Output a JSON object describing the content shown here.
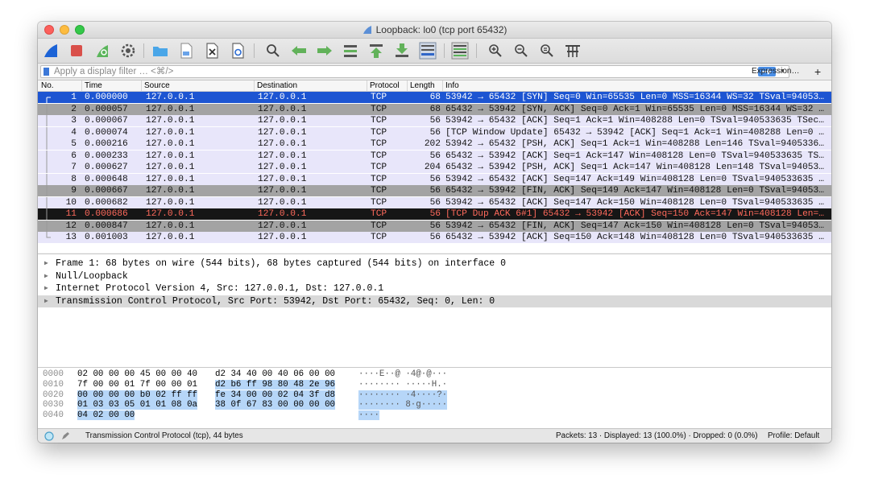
{
  "window": {
    "title": "Loopback: lo0 (tcp port 65432)"
  },
  "filter": {
    "placeholder": "Apply a display filter … <⌘/>",
    "expression_label": "Expression…",
    "add_label": "+"
  },
  "columns": [
    "No.",
    "Time",
    "Source",
    "Destination",
    "Protocol",
    "Length",
    "Info"
  ],
  "packets": [
    {
      "no": "1",
      "time": "0.000000",
      "src": "127.0.0.1",
      "dst": "127.0.0.1",
      "proto": "TCP",
      "len": "68",
      "info": "53942 → 65432 [SYN] Seq=0 Win=65535 Len=0 MSS=16344 WS=32 TSval=94053…",
      "style": "selected"
    },
    {
      "no": "2",
      "time": "0.000057",
      "src": "127.0.0.1",
      "dst": "127.0.0.1",
      "proto": "TCP",
      "len": "68",
      "info": "65432 → 53942 [SYN, ACK] Seq=0 Ack=1 Win=65535 Len=0 MSS=16344 WS=32 …",
      "style": "gray"
    },
    {
      "no": "3",
      "time": "0.000067",
      "src": "127.0.0.1",
      "dst": "127.0.0.1",
      "proto": "TCP",
      "len": "56",
      "info": "53942 → 65432 [ACK] Seq=1 Ack=1 Win=408288 Len=0 TSval=940533635 TSec…",
      "style": "normal"
    },
    {
      "no": "4",
      "time": "0.000074",
      "src": "127.0.0.1",
      "dst": "127.0.0.1",
      "proto": "TCP",
      "len": "56",
      "info": "[TCP Window Update] 65432 → 53942 [ACK] Seq=1 Ack=1 Win=408288 Len=0 …",
      "style": "normal"
    },
    {
      "no": "5",
      "time": "0.000216",
      "src": "127.0.0.1",
      "dst": "127.0.0.1",
      "proto": "TCP",
      "len": "202",
      "info": "53942 → 65432 [PSH, ACK] Seq=1 Ack=1 Win=408288 Len=146 TSval=9405336…",
      "style": "normal"
    },
    {
      "no": "6",
      "time": "0.000233",
      "src": "127.0.0.1",
      "dst": "127.0.0.1",
      "proto": "TCP",
      "len": "56",
      "info": "65432 → 53942 [ACK] Seq=1 Ack=147 Win=408128 Len=0 TSval=940533635 TS…",
      "style": "normal"
    },
    {
      "no": "7",
      "time": "0.000627",
      "src": "127.0.0.1",
      "dst": "127.0.0.1",
      "proto": "TCP",
      "len": "204",
      "info": "65432 → 53942 [PSH, ACK] Seq=1 Ack=147 Win=408128 Len=148 TSval=94053…",
      "style": "normal"
    },
    {
      "no": "8",
      "time": "0.000648",
      "src": "127.0.0.1",
      "dst": "127.0.0.1",
      "proto": "TCP",
      "len": "56",
      "info": "53942 → 65432 [ACK] Seq=147 Ack=149 Win=408128 Len=0 TSval=940533635 …",
      "style": "normal"
    },
    {
      "no": "9",
      "time": "0.000667",
      "src": "127.0.0.1",
      "dst": "127.0.0.1",
      "proto": "TCP",
      "len": "56",
      "info": "65432 → 53942 [FIN, ACK] Seq=149 Ack=147 Win=408128 Len=0 TSval=94053…",
      "style": "gray"
    },
    {
      "no": "10",
      "time": "0.000682",
      "src": "127.0.0.1",
      "dst": "127.0.0.1",
      "proto": "TCP",
      "len": "56",
      "info": "53942 → 65432 [ACK] Seq=147 Ack=150 Win=408128 Len=0 TSval=940533635 …",
      "style": "normal"
    },
    {
      "no": "11",
      "time": "0.000686",
      "src": "127.0.0.1",
      "dst": "127.0.0.1",
      "proto": "TCP",
      "len": "56",
      "info": "[TCP Dup ACK 6#1] 65432 → 53942 [ACK] Seq=150 Ack=147 Win=408128 Len=…",
      "style": "error"
    },
    {
      "no": "12",
      "time": "0.000847",
      "src": "127.0.0.1",
      "dst": "127.0.0.1",
      "proto": "TCP",
      "len": "56",
      "info": "53942 → 65432 [FIN, ACK] Seq=147 Ack=150 Win=408128 Len=0 TSval=94053…",
      "style": "gray"
    },
    {
      "no": "13",
      "time": "0.001003",
      "src": "127.0.0.1",
      "dst": "127.0.0.1",
      "proto": "TCP",
      "len": "56",
      "info": "65432 → 53942 [ACK] Seq=150 Ack=148 Win=408128 Len=0 TSval=940533635 …",
      "style": "normal"
    }
  ],
  "details": [
    {
      "text": "Frame 1: 68 bytes on wire (544 bits), 68 bytes captured (544 bits) on interface 0",
      "selected": false
    },
    {
      "text": "Null/Loopback",
      "selected": false
    },
    {
      "text": "Internet Protocol Version 4, Src: 127.0.0.1, Dst: 127.0.0.1",
      "selected": false
    },
    {
      "text": "Transmission Control Protocol, Src Port: 53942, Dst Port: 65432, Seq: 0, Len: 0",
      "selected": true
    }
  ],
  "bytes": [
    {
      "offset": "0000",
      "hex1": "02 00 00 00 45 00 00 40",
      "hex2": "d2 34 40 00 40 06 00 00",
      "ascii": "····E··@ ·4@·@···",
      "hl": 0
    },
    {
      "offset": "0010",
      "hex1": "7f 00 00 01 7f 00 00 01",
      "hex2": "d2 b6 ff 98 80 48 2e 96",
      "ascii": "········ ·····H.·",
      "hl": 1
    },
    {
      "offset": "0020",
      "hex1": "00 00 00 00 b0 02 ff ff",
      "hex2": "fe 34 00 00 02 04 3f d8",
      "ascii": "········ ·4····?·",
      "hl": 2
    },
    {
      "offset": "0030",
      "hex1": "01 03 03 05 01 01 08 0a",
      "hex2": "38 0f 67 83 00 00 00 00",
      "ascii": "········ 8·g·····",
      "hl": 2
    },
    {
      "offset": "0040",
      "hex1": "04 02 00 00",
      "hex2": "",
      "ascii": "····",
      "hl": 3
    }
  ],
  "status": {
    "left": "Transmission Control Protocol (tcp), 44 bytes",
    "right": "Packets: 13 · Displayed: 13 (100.0%) · Dropped: 0 (0.0%)",
    "profile": "Profile: Default"
  },
  "colors": {
    "selected_bg": "#1d55d2",
    "gray_bg": "#a3a3a3",
    "normal_bg": "#e8e6fa",
    "error_bg": "#161616",
    "error_fg": "#ff6a5c",
    "bytes_highlight": "#b6d6f8"
  },
  "toolbar_icons": [
    "shark-fin-start-icon",
    "stop-icon",
    "restart-icon",
    "options-gear-icon",
    "open-folder-icon",
    "save-file-icon",
    "close-file-icon",
    "reload-icon",
    "find-icon",
    "back-arrow-icon",
    "forward-arrow-icon",
    "go-to-packet-icon",
    "first-packet-icon",
    "last-packet-icon",
    "autoscroll-icon",
    "colorize-icon",
    "zoom-in-icon",
    "zoom-out-icon",
    "zoom-reset-icon",
    "resize-columns-icon"
  ]
}
